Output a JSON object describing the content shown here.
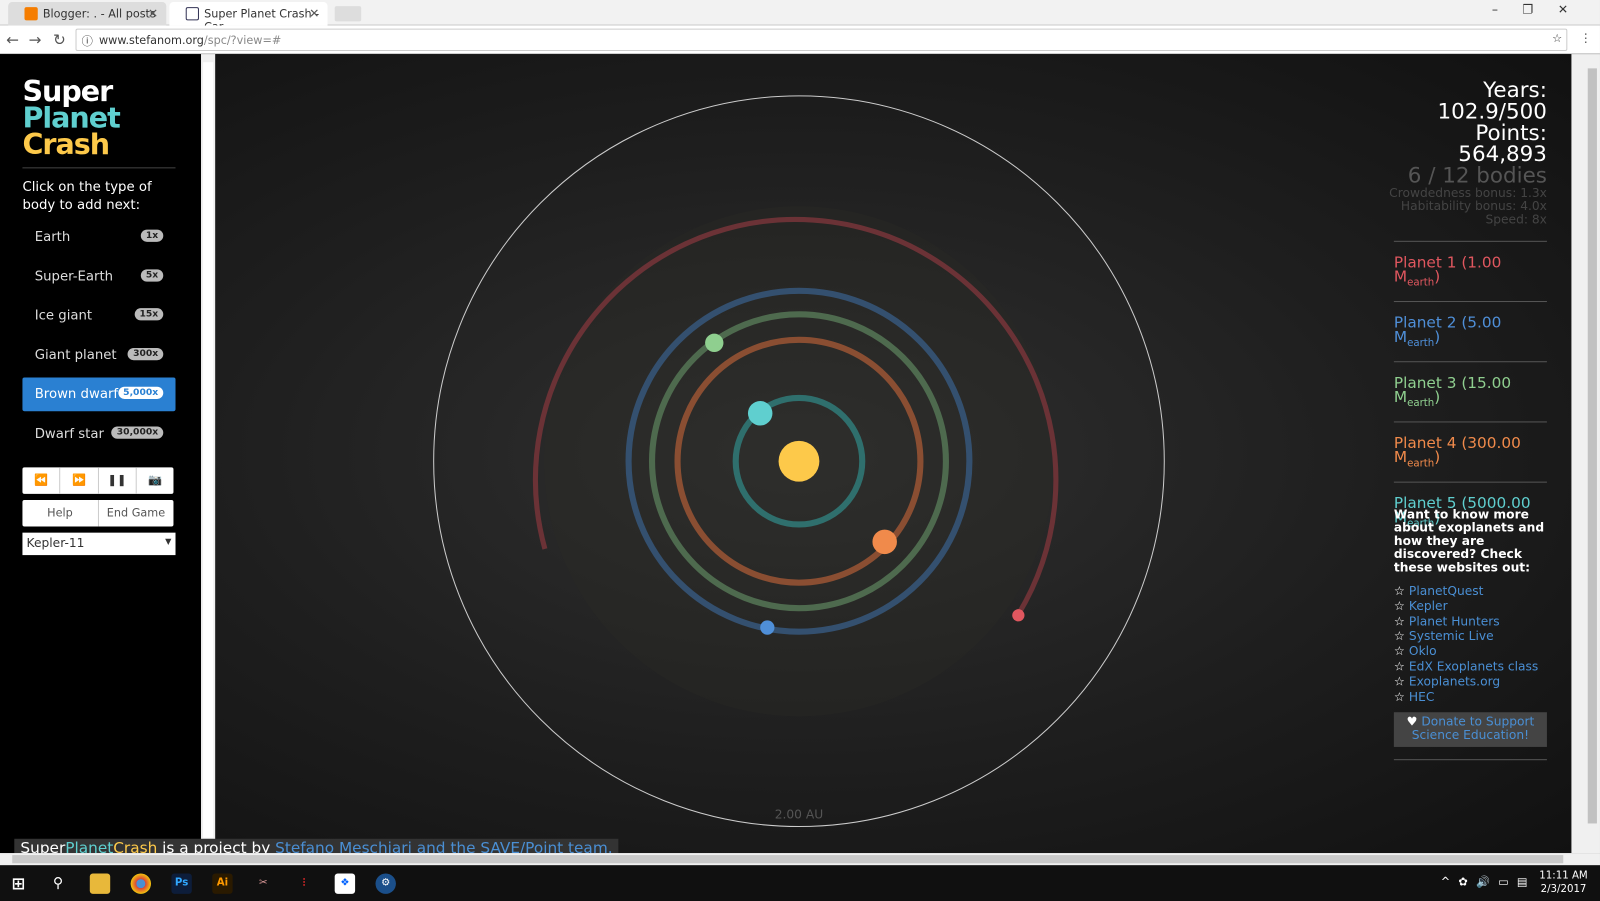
{
  "browser": {
    "tabs": [
      {
        "label": "Blogger: . - All posts"
      },
      {
        "label": "Super Planet Crash - Car"
      }
    ],
    "url_host": "www.stefanom.org",
    "url_path": "/spc/?view=#"
  },
  "logo": {
    "line1": "Super",
    "line2": "Planet",
    "line3": "Crash"
  },
  "sidebar": {
    "prompt": "Click on the type of body to add next:",
    "body_types": [
      {
        "label": "Earth",
        "badge": "1x"
      },
      {
        "label": "Super-Earth",
        "badge": "5x"
      },
      {
        "label": "Ice giant",
        "badge": "15x"
      },
      {
        "label": "Giant planet",
        "badge": "300x"
      },
      {
        "label": "Brown dwarf",
        "badge": "5,000x",
        "selected": true
      },
      {
        "label": "Dwarf star",
        "badge": "30,000x"
      }
    ],
    "controls": {
      "rewind": "⏪",
      "forward": "⏩",
      "pause": "❚❚",
      "camera": "📷"
    },
    "help": "Help",
    "end_game": "End Game",
    "preset": "Kepler-11"
  },
  "stats": {
    "years_label": "Years:",
    "years": "102.9/500",
    "points_label": "Points:",
    "points": "564,893",
    "bodies": "6 / 12 bodies",
    "crowdedness": "Crowdedness bonus: 1.3x",
    "habitability": "Habitability bonus: 4.0x",
    "speed": "Speed: 8x"
  },
  "planets": [
    {
      "name": "Planet 1 (1.00 M",
      "sub": "earth",
      "end": ")",
      "color": "#e0575f"
    },
    {
      "name": "Planet 2 (5.00 M",
      "sub": "earth",
      "end": ")",
      "color": "#4f8fd8"
    },
    {
      "name": "Planet 3 (15.00 M",
      "sub": "earth",
      "end": ")",
      "color": "#8fcf8f"
    },
    {
      "name": "Planet 4 (300.00 M",
      "sub": "earth",
      "end": ")",
      "color": "#f08a4b"
    },
    {
      "name": "Planet 5 (5000.00 M",
      "sub": "earth",
      "end": ")",
      "color": "#5fcfcf"
    }
  ],
  "info": {
    "text": "Want to know more about exoplanets and how they are discovered? Check these websites out:",
    "links": [
      "PlanetQuest",
      "Kepler",
      "Planet Hunters",
      "Systemic Live",
      "Oklo",
      "EdX Exoplanets class",
      "Exoplanets.org",
      "HEC"
    ],
    "donate": "Donate to Support Science Education!"
  },
  "scale_label": "2.00 AU",
  "footer": {
    "a": "Super",
    "b": "Planet",
    "c": "Crash",
    "d": " is a project by ",
    "link": "Stefano Meschiari and the SAVE/Point team."
  },
  "taskbar": {
    "time": "11:11 AM",
    "date": "2/3/2017"
  },
  "colors": {
    "star": "#fdc94a",
    "accent": "#2a80d2"
  }
}
